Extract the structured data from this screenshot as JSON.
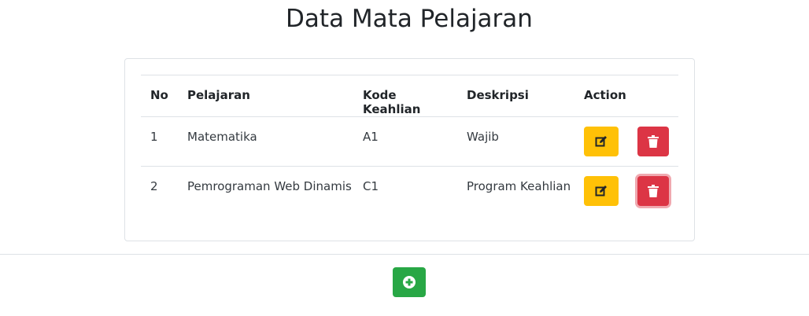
{
  "page": {
    "title": "Data Mata Pelajaran"
  },
  "table": {
    "headers": {
      "no": "No",
      "pelajaran": "Pelajaran",
      "kode": "Kode Keahlian",
      "deskripsi": "Deskripsi",
      "action": "Action"
    },
    "rows": [
      {
        "no": "1",
        "pelajaran": "Matematika",
        "kode": "A1",
        "deskripsi": "Wajib"
      },
      {
        "no": "2",
        "pelajaran": "Pemrograman Web Dinamis",
        "kode": "C1",
        "deskripsi": "Program Keahlian"
      }
    ]
  },
  "icons": {
    "edit": "edit-icon",
    "delete": "trash-icon",
    "add": "plus-circle-icon"
  },
  "colors": {
    "edit_button": "#ffc107",
    "delete_button": "#dc3545",
    "add_button": "#28a745"
  }
}
